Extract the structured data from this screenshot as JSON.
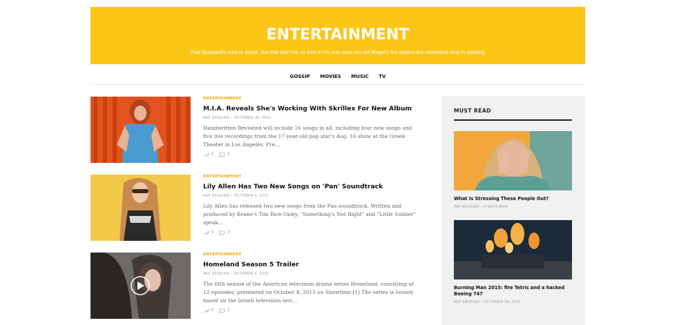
{
  "hero": {
    "title": "ENTERTAINMENT",
    "subtitle": "That Spaniard's mad or drunk. But that can't be, or else in his one case our old Mogul's fire-waters are somewhat long in working."
  },
  "nav": [
    "GOSSIP",
    "MOVIES",
    "MUSIC",
    "TV"
  ],
  "posts": [
    {
      "category": "ENTERTAINMENT",
      "title": "M.I.A. Reveals She's Working With Skrillex For New Album",
      "author": "ANT EKSILER",
      "sep": "–",
      "date": "OCTOBER 30, 2015",
      "excerpt": "Handwritten Revisited will include 16 songs in all, including four new songs and five live recordings from the 17-year-old pop star's Aug. 16 show at the Greek Theater in Los Angeles. Pre…",
      "shares": "0",
      "comments": "0"
    },
    {
      "category": "ENTERTAINMENT",
      "title": "Lily Allen Has Two New Songs on 'Pan' Soundtrack",
      "author": "ANT EKSILER",
      "sep": "–",
      "date": "OCTOBER 6, 2015",
      "excerpt": "Lily Allen has released two new songs from the Pan soundtrack. Written and produced by Keane's Tim Rice-Oxley, \"Something's Not Right\" and \"Little Soldier\" speak…",
      "shares": "0",
      "comments": "0"
    },
    {
      "category": "ENTERTAINMENT",
      "title": "Homeland Season 5 Trailer",
      "author": "ANT EKSILER",
      "sep": "–",
      "date": "OCTOBER 6, 2015",
      "excerpt": "The fifth season of the American television drama series Homeland, consisting of 12 episodes, premiered on October 4, 2015 on Showtime.[1] The series is loosely based on the Israeli television seri…",
      "shares": "0",
      "comments": "0"
    }
  ],
  "sidebar": {
    "heading": "MUST READ",
    "items": [
      {
        "title": "What Is Stressing These People Out?",
        "author": "ANT EKSILER",
        "sep": "–",
        "date": "4 DAYS AGO"
      },
      {
        "title": "Burning Man 2015: fire Tetris and a hacked Boeing 747",
        "author": "ANT EKSILER",
        "sep": "–",
        "date": "OCTOBER 30, 2015"
      }
    ]
  },
  "colors": {
    "accent": "#fbc617",
    "category": "#f0a500"
  },
  "icons": {
    "shares": "trend-arrow-icon",
    "comments": "comment-bubble-icon",
    "play": "play-icon"
  }
}
